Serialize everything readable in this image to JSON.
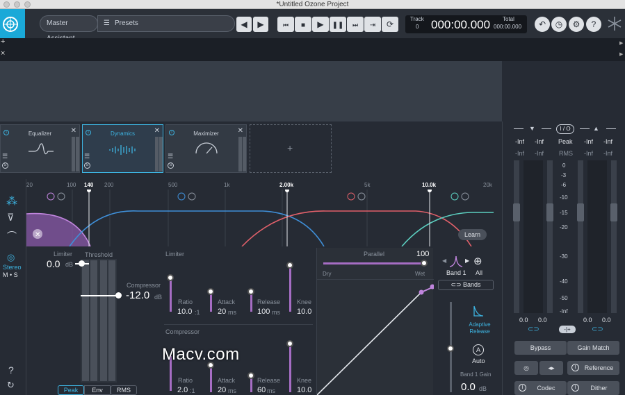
{
  "window": {
    "title": "*Untitled Ozone Project"
  },
  "toolbar": {
    "master_assistant": "Master Assistant",
    "presets": "Presets",
    "track_label": "Track",
    "track_num": "0",
    "time": "000:00.000",
    "total_label": "Total",
    "total_time": "000:00.000"
  },
  "side": {
    "plus": "+",
    "close": "×"
  },
  "modules": [
    {
      "name": "Equalizer"
    },
    {
      "name": "Dynamics"
    },
    {
      "name": "Maximizer"
    }
  ],
  "add_module": "+",
  "freq_ticks": [
    "20",
    "100",
    "140",
    "200",
    "500",
    "1k",
    "2.00k",
    "5k",
    "10.0k",
    "20k"
  ],
  "learn": "Learn",
  "left_tools": {
    "stereo": "Stereo",
    "ms": "M • S",
    "help": "?"
  },
  "limiter_top": {
    "label": "Limiter",
    "value": "0.0",
    "unit": "dB"
  },
  "threshold": "Threshold",
  "compressor_thr": {
    "label": "Compressor",
    "value": "-12.0",
    "unit": "dB"
  },
  "detect": [
    "Peak",
    "Env",
    "RMS"
  ],
  "limiter": {
    "title": "Limiter",
    "ratio_label": "Ratio",
    "ratio": "10.0",
    "ratio_unit": ":1",
    "attack_label": "Attack",
    "attack": "20",
    "attack_unit": "ms",
    "release_label": "Release",
    "release": "100",
    "release_unit": "ms",
    "knee_label": "Knee",
    "knee": "10.0"
  },
  "compressor": {
    "title": "Compressor",
    "ratio_label": "Ratio",
    "ratio": "2.0",
    "ratio_unit": ":1",
    "attack_label": "Attack",
    "attack": "20",
    "attack_unit": "ms",
    "release_label": "Release",
    "release": "60",
    "release_unit": "ms",
    "knee_label": "Knee",
    "knee": "10.0"
  },
  "parallel": {
    "label": "Parallel",
    "value": "100",
    "dry": "Dry",
    "wet": "Wet"
  },
  "band": {
    "band1": "Band 1",
    "all": "All",
    "bands": "Bands",
    "adaptive": "Adaptive Release",
    "auto_letter": "A",
    "auto": "Auto",
    "gain_label": "Band 1 Gain",
    "gain": "0.0",
    "gain_unit": "dB"
  },
  "meter": {
    "io": "I / O",
    "peak": "Peak",
    "rms": "RMS",
    "inf": "-Inf",
    "scale": [
      "0",
      "-3",
      "-6",
      "-10",
      "-15",
      "-20",
      "-30",
      "-40",
      "-50",
      "-Inf"
    ],
    "left_vals": [
      "0.0",
      "0.0"
    ],
    "right_vals": [
      "0.0",
      "0.0"
    ],
    "bypass": "Bypass",
    "gain_match": "Gain Match",
    "reference": "Reference",
    "codec": "Codec",
    "dither": "Dither"
  },
  "watermark": "Macv.com",
  "colors": {
    "accent": "#1aa9d8",
    "purple": "#a66dc4",
    "blue": "#3f8fd8",
    "red": "#e0606a",
    "teal": "#5ccfc0"
  }
}
